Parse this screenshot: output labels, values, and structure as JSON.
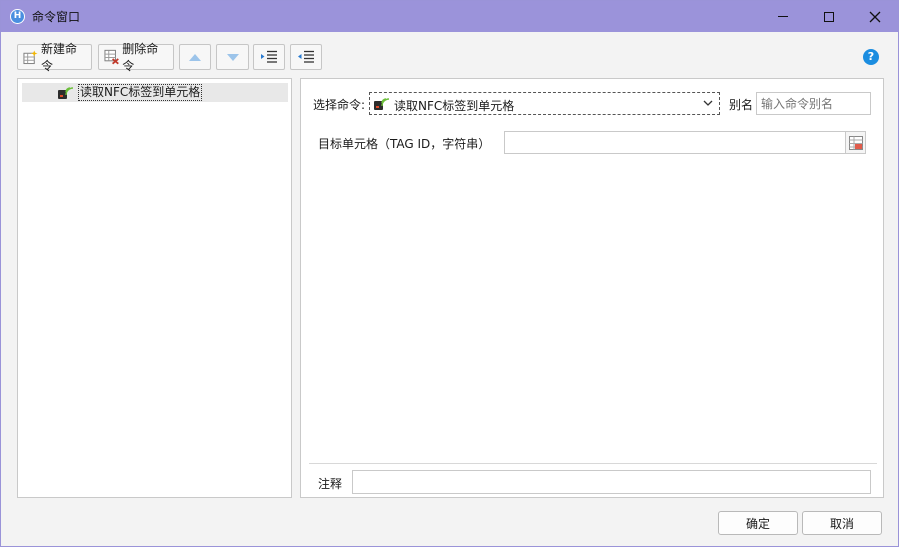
{
  "window": {
    "title": "命令窗口",
    "app_icon_letter": "H"
  },
  "toolbar": {
    "new_label": "新建命令",
    "delete_label": "删除命令"
  },
  "tree": {
    "items": [
      {
        "label": "读取NFC标签到单元格"
      }
    ]
  },
  "form": {
    "select_label": "选择命令:",
    "selected_command": "读取NFC标签到单元格",
    "alias_label": "别名",
    "alias_placeholder": "输入命令别名",
    "target_label": "目标单元格（TAG ID，字符串）",
    "target_value": "",
    "note_label": "注释",
    "note_value": ""
  },
  "footer": {
    "ok_label": "确定",
    "cancel_label": "取消"
  },
  "colors": {
    "titlebar": "#9b93da",
    "help": "#1b8de0",
    "arrow": "#9cc4ea"
  }
}
